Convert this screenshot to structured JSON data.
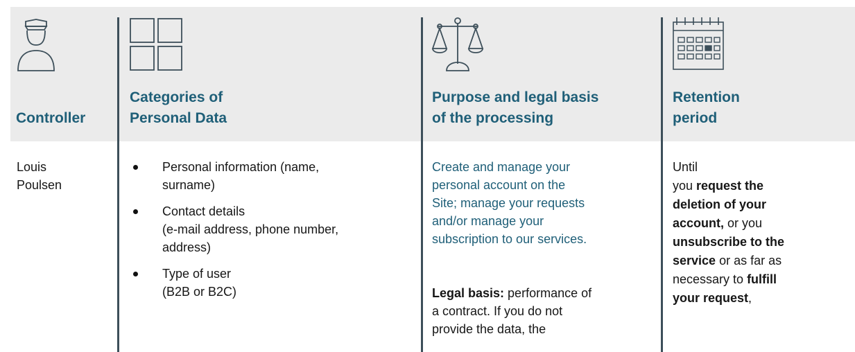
{
  "columns": {
    "controller": {
      "header": "Controller",
      "icon": "police-officer-icon",
      "body_lines": [
        "Louis",
        "Poulsen"
      ]
    },
    "categories": {
      "header_lines": [
        "Categories of",
        "Personal Data"
      ],
      "icon": "grid-icon",
      "items": [
        {
          "lines": [
            "Personal information (name,",
            "surname)"
          ]
        },
        {
          "lines": [
            "Contact details",
            "(e-mail address, phone number,",
            "address)"
          ]
        },
        {
          "lines": [
            "Type of user",
            "(B2B or B2C)"
          ]
        }
      ]
    },
    "purpose": {
      "header_lines": [
        "Purpose and legal basis",
        "of the processing"
      ],
      "icon": "scales-icon",
      "purpose_lines": [
        "Create and manage your",
        "personal account on the",
        "Site; manage your requests",
        "and/or manage your",
        "subscription to our services."
      ],
      "legal_label": "Legal basis:",
      "legal_line1": " performance of",
      "legal_lines": [
        "a contract. If you do not",
        "provide the data, the"
      ]
    },
    "retention": {
      "header_lines": [
        "Retention",
        "period"
      ],
      "icon": "calendar-icon",
      "l1": "Until",
      "l2a": "you ",
      "l2b": "request the",
      "l3": "deletion of your",
      "l4a": "account,",
      "l4b": " or you",
      "l5": "unsubscribe to the",
      "l6a": "service",
      "l6b": " or as far as",
      "l7a": "necessary to ",
      "l7b": "fulfill",
      "l8a": "your request",
      "l8b": ","
    }
  },
  "colors": {
    "header_bg": "#ebebeb",
    "header_text": "#1f5f78",
    "divider": "#3d4f5a",
    "icon_stroke": "#3d4f5a"
  }
}
